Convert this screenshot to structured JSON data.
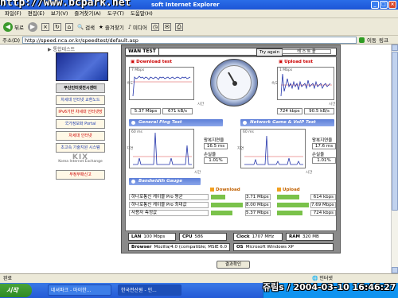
{
  "window": {
    "watermark": "http://www.bcpark.net",
    "title": "soft Internet Explorer"
  },
  "menu": [
    "파일(F)",
    "편집(E)",
    "보기(V)",
    "즐겨찾기(A)",
    "도구(T)",
    "도움말(H)"
  ],
  "toolbar": {
    "back": "뒤로",
    "search": "검색",
    "favorites": "즐겨찾기",
    "media": "미디어"
  },
  "address": {
    "label": "주소(D)",
    "url": "http://speed.nca.or.kr/speedtest/default.asp",
    "go": "이동",
    "links": "링크"
  },
  "page": {
    "breadcrumb": "▶ 통합테스트",
    "nav": [
      {
        "label": "부산인터넷전시센터",
        "style": "sel"
      },
      {
        "label": "차세대 인터넷 교환노드",
        "style": "blue"
      },
      {
        "label": "IPv6기반 차세대 인터넷망",
        "style": "red"
      },
      {
        "label": "국가정보화 Portal",
        "style": "blue"
      },
      {
        "label": "차세대 인터넷",
        "style": "red"
      },
      {
        "label": "초고속 기술지원 시스템",
        "style": "blue"
      }
    ],
    "kix": {
      "mark": "KIX",
      "label": "Korea Internet Exchange"
    },
    "report_btn": "부정부패신고"
  },
  "speedtest": {
    "tab": "WAN TEST",
    "try_again": "Try again",
    "test_label": "테 스 트 끝",
    "download": {
      "title": "Download test",
      "scale": "7 Mbps",
      "axis_x": "시간",
      "axis_y": "속도",
      "kbps": "5.37 Mbps",
      "kBs": "671 kB/s"
    },
    "upload": {
      "title": "Upload test",
      "scale": "1 Mbps",
      "axis_x": "시간",
      "axis_y": "속도",
      "kbps": "724 kbps",
      "kBs": "90.5 kB/s"
    },
    "ping": {
      "heading": "General Ping Test",
      "scale": "60 ms",
      "axis_x": "시간",
      "axis_y": "지연",
      "rtt_label": "왕복지연율",
      "rtt": "16.5 ms",
      "loss_label": "손실율",
      "loss": "1.01%"
    },
    "voip": {
      "heading": "Network Game & VoIP Test",
      "scale": "60 ms",
      "axis_x": "시간",
      "axis_y": "지연",
      "rtt_label": "왕복지연율",
      "rtt": "17.6 ms",
      "loss_label": "손실율",
      "loss": "1.01%"
    },
    "bandwidth": {
      "heading": "Bandwidth Gauge",
      "download_label": "Download",
      "upload_label": "Upload",
      "rows": [
        {
          "name": "하나로통신 케이블 Pro 평균",
          "down": "3.71 Mbps",
          "up": "614 kbps",
          "down_frac": 0.45,
          "up_frac": 0.7
        },
        {
          "name": "하나로통신 케이블 Pro 최대값",
          "down": "8.00 Mbps",
          "up": "7.69 Mbps",
          "down_frac": 1.0,
          "up_frac": 1.0
        },
        {
          "name": "사용자 측정값",
          "down": "5.37 Mbps",
          "up": "724 kbps",
          "down_frac": 0.67,
          "up_frac": 0.8
        }
      ]
    },
    "sys": {
      "lan_label": "LAN",
      "lan": "100 Mbps",
      "cpu_label": "CPU",
      "cpu": "586",
      "clock_label": "Clock",
      "clock": "1707 MHz",
      "ram_label": "RAM",
      "ram": "320 MB",
      "browser_label": "Browser",
      "browser": "Mozilla/4.0 (compatible; MSIE 6.0",
      "os_label": "OS",
      "os": "Microsoft Windows XP"
    },
    "confirm": "결과확인"
  },
  "status": {
    "left": "완료",
    "zone": "인터넷"
  },
  "taskbar": {
    "start": "시작",
    "tasks": [
      "네셔파크 - 마이한...",
      "한국전산원 - 인..."
    ]
  },
  "stamp": "쥬림s / 2004-03-10 16:46:27"
}
